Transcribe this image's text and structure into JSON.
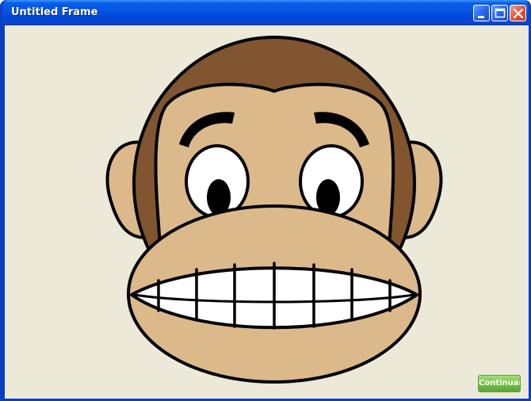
{
  "window": {
    "title": "Untitled Frame",
    "controls": [
      {
        "name": "minimize-button",
        "icon": "minimize-icon"
      },
      {
        "name": "maximize-button",
        "icon": "maximize-icon"
      },
      {
        "name": "close-button",
        "icon": "close-icon"
      }
    ]
  },
  "content": {
    "illustration": "grinning-monkey-face",
    "continue_label": "Continuar"
  },
  "colors": {
    "titlebar_blue": "#0454e0",
    "window_bg": "#ece9d8",
    "fur_brown": "#80552f",
    "skin_tan": "#dcb98a",
    "button_green": "#78c24c",
    "close_red": "#e1583a"
  }
}
